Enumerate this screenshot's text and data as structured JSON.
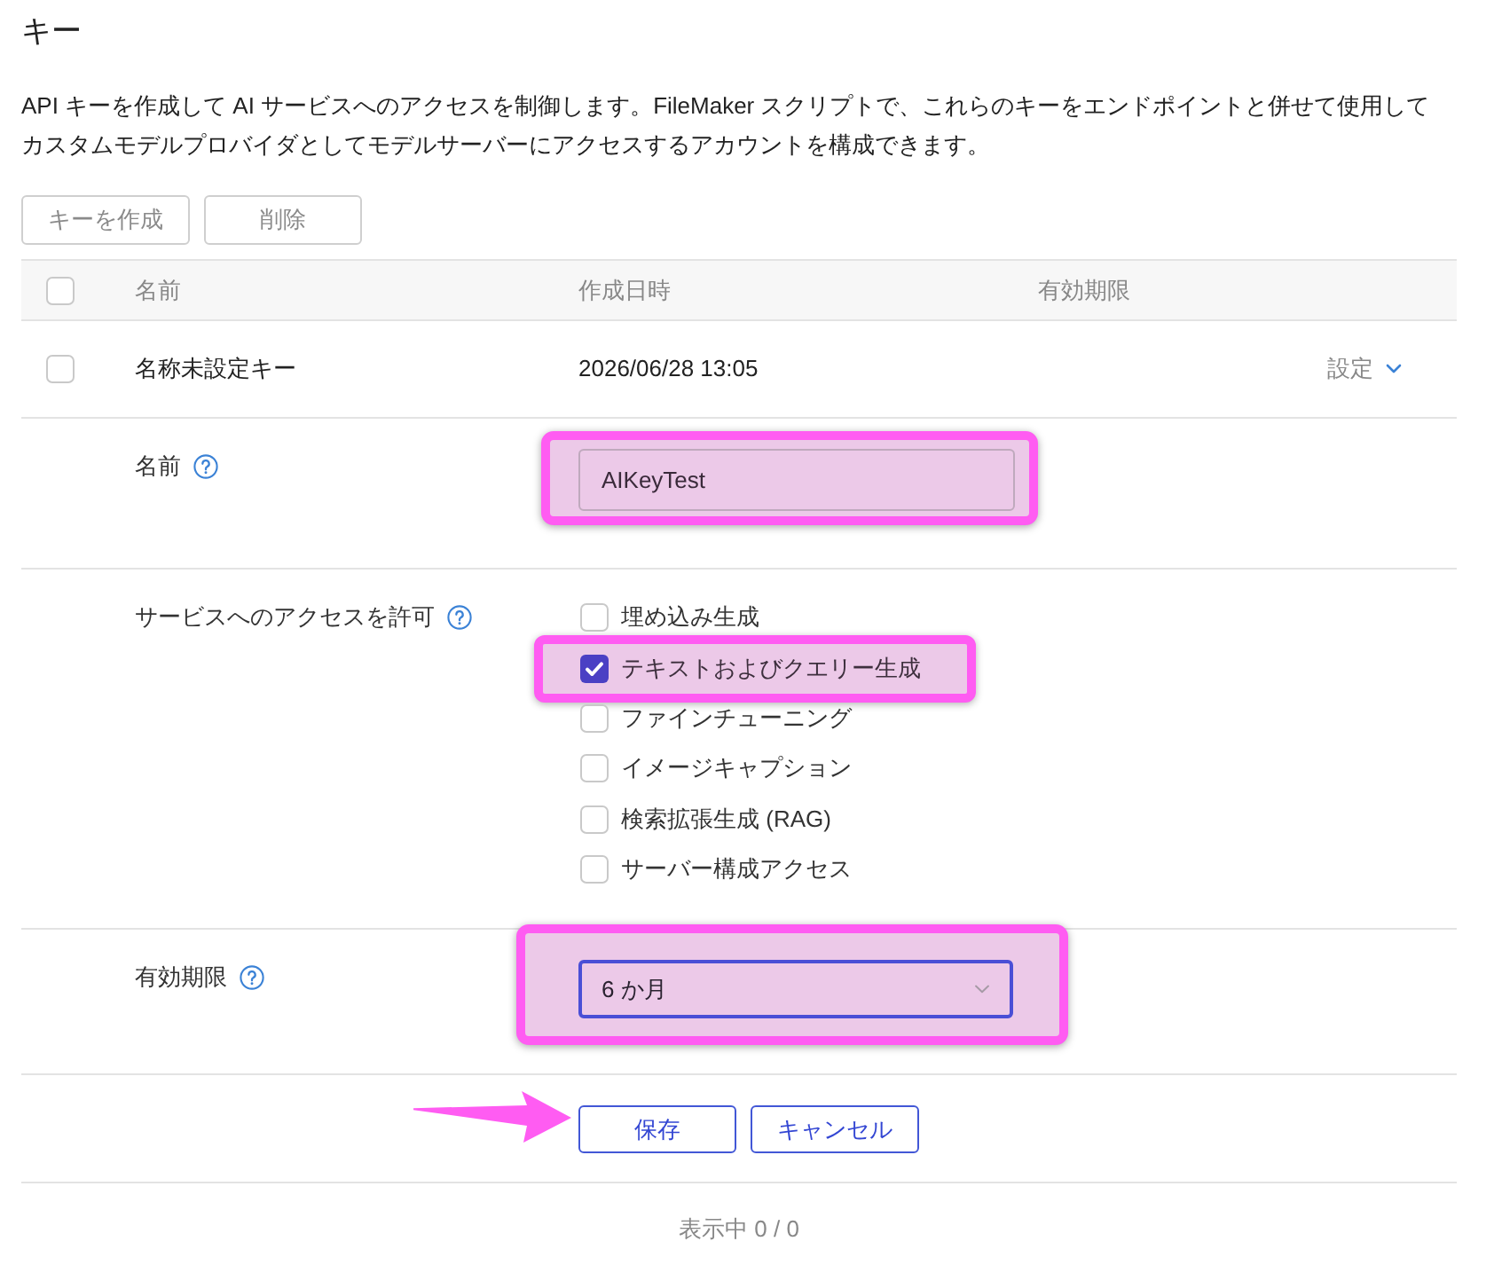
{
  "title": "キー",
  "description": "API キーを作成して AI サービスへのアクセスを制御します。FileMaker スクリプトで、これらのキーをエンドポイントと併せて使用してカスタムモデルプロバイダとしてモデルサーバーにアクセスするアカウントを構成できます。",
  "toolbar": [
    {
      "label": "キーを作成",
      "disabled": true
    },
    {
      "label": "削除",
      "disabled": true
    }
  ],
  "table": {
    "select_all": {
      "checked": false
    },
    "columns": [
      "名前",
      "作成日時",
      "有効期限"
    ],
    "rows": [
      {
        "checked": false,
        "name": "名称未設定キー",
        "created": "2026/06/28 13:05",
        "menu": "設定"
      }
    ]
  },
  "edit_form": {
    "name_field": {
      "label": "名前",
      "value": "AIKeyTest",
      "highlighted": true
    },
    "access": {
      "label": "サービスへのアクセスを許可",
      "options": [
        {
          "label": "埋め込み生成",
          "checked": false,
          "highlighted": false
        },
        {
          "label": "テキストおよびクエリー生成",
          "checked": true,
          "highlighted": true
        },
        {
          "label": "ファインチューニング",
          "checked": false,
          "highlighted": false
        },
        {
          "label": "イメージキャプション",
          "checked": false,
          "highlighted": false
        },
        {
          "label": "検索拡張生成 (RAG)",
          "checked": false,
          "highlighted": false
        },
        {
          "label": "サーバー構成アクセス",
          "checked": false,
          "highlighted": false
        }
      ]
    },
    "expiry": {
      "label": "有効期限",
      "value": "6 か月",
      "focused": true,
      "highlighted": true
    },
    "buttons": [
      {
        "label": "保存",
        "pointed_at": true
      },
      {
        "label": "キャンセル",
        "pointed_at": false
      }
    ]
  },
  "footer": "表示中 0 / 0"
}
